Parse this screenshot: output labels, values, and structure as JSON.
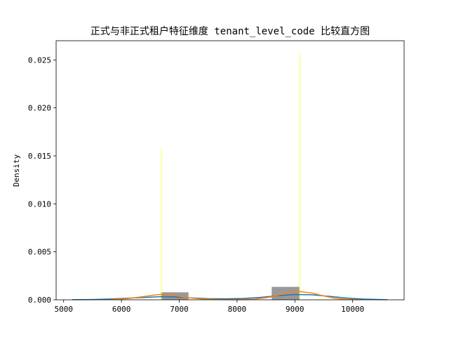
{
  "chart_data": {
    "type": "histogram",
    "title": "正式与非正式租户特征维度 tenant_level_code 比较直方图",
    "xlabel": "",
    "ylabel": "Density",
    "xlim": [
      4870,
      10890
    ],
    "ylim": [
      0,
      0.027
    ],
    "xticks": [
      5000,
      6000,
      7000,
      8000,
      9000,
      10000
    ],
    "yticks": [
      0.0,
      0.005,
      0.01,
      0.015,
      0.02,
      0.025
    ],
    "ytick_labels": [
      "0.000",
      "0.005",
      "0.010",
      "0.015",
      "0.020",
      "0.025"
    ],
    "grid": false,
    "legend": null,
    "bars": [
      {
        "x0": 6680,
        "x1": 7160,
        "density": 0.00078,
        "color": "#808080",
        "opacity": 0.8
      },
      {
        "x0": 8600,
        "x1": 9080,
        "density": 0.00135,
        "color": "#808080",
        "opacity": 0.8
      }
    ],
    "spikes": [
      {
        "x": 6690,
        "density": 0.0157,
        "color": "#ffff66"
      },
      {
        "x": 9085,
        "density": 0.0257,
        "color": "#ffff66"
      }
    ],
    "series": [
      {
        "color": "#1f77b4",
        "x": [
          5150,
          5500,
          5800,
          6100,
          6400,
          6700,
          6900,
          7200,
          7500,
          7800,
          8100,
          8400,
          8700,
          9000,
          9300,
          9600,
          9900,
          10200,
          10600
        ],
        "y": [
          1e-05,
          3e-05,
          8e-05,
          0.00016,
          0.00025,
          0.00033,
          0.0003,
          0.0002,
          0.00012,
          0.0001,
          0.00014,
          0.00025,
          0.00042,
          0.00055,
          0.00052,
          0.00036,
          0.00018,
          7e-05,
          1e-05
        ]
      },
      {
        "color": "#ff7f0e",
        "x": [
          5800,
          6100,
          6400,
          6600,
          6750,
          6900,
          7100,
          7400,
          7700,
          8000,
          8300,
          8600,
          8800,
          9000,
          9100,
          9300,
          9500,
          9700,
          9900,
          10150
        ],
        "y": [
          2e-05,
          0.00012,
          0.00035,
          0.00052,
          0.00058,
          0.00048,
          0.00025,
          8e-05,
          2e-05,
          1e-05,
          6e-05,
          0.0003,
          0.00062,
          0.00082,
          0.00085,
          0.0007,
          0.0004,
          0.00015,
          5e-05,
          1e-05
        ]
      }
    ]
  }
}
